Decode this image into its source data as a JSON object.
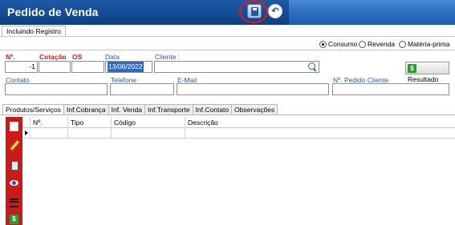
{
  "window": {
    "title": "Pedido de Venda"
  },
  "toolbar": {
    "save_icon": "save-disk-icon",
    "undo_icon": "undo-icon",
    "undo_glyph": "↶"
  },
  "subtab": {
    "label": "Incluindo Registro"
  },
  "radios": {
    "consumo": {
      "label": "Consumo",
      "checked": true
    },
    "revenda": {
      "label": "Revenda",
      "checked": false
    },
    "materia": {
      "label": "Matéria-prima",
      "checked": false
    }
  },
  "header": {
    "numero_label": "Nº.",
    "numero_value": "-1",
    "cotacao_label": "Cotação",
    "os_label": "OS",
    "data_label": "Data",
    "data_value": "13/06/2022",
    "cliente_label": "Cliente :",
    "resultado_label": "Resultado",
    "dollar_glyph": "$"
  },
  "contact": {
    "contato_label": "Contato",
    "telefone_label": "Telefone",
    "email_label": "E-Mail",
    "pedido_cliente_label": "Nº. Pedido Cliente"
  },
  "tabs": [
    {
      "label": "Produtos/Serviços",
      "active": true
    },
    {
      "label": "Inf.Cobrança",
      "active": false
    },
    {
      "label": "Inf. Venda",
      "active": false
    },
    {
      "label": "Inf.Transporte",
      "active": false
    },
    {
      "label": "Inf.Contato",
      "active": false
    },
    {
      "label": "Observações",
      "active": false
    }
  ],
  "grid": {
    "columns": [
      "Nº.",
      "Tipo",
      "Código",
      "Descrição"
    ]
  },
  "sidebar": {
    "icons": [
      "new-document-icon",
      "edit-pencil-icon",
      "delete-trash-icon",
      "view-eye-icon",
      "list-icon",
      "money-icon"
    ],
    "money_glyph": "$"
  },
  "colors": {
    "title_bar": "#154b92",
    "sidebar": "#cc1919",
    "required_label": "#d21a1a",
    "optional_label": "#2a57b8",
    "highlight_ring": "#e01818"
  }
}
